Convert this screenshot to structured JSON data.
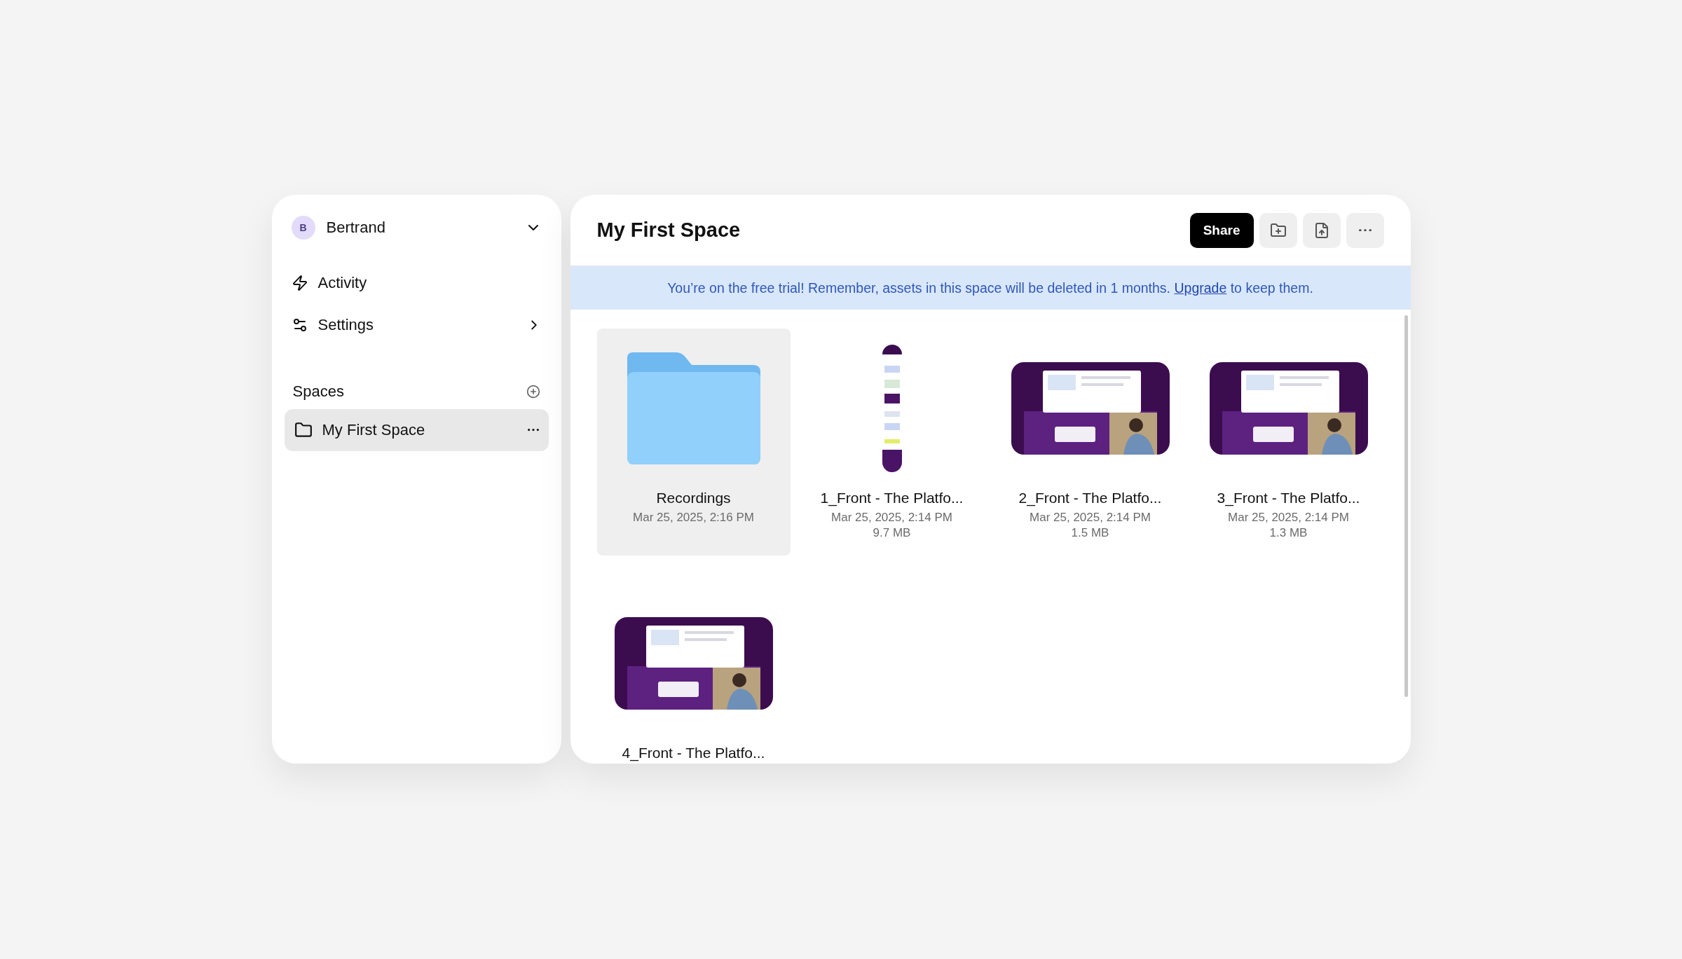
{
  "sidebar": {
    "user": {
      "initial": "B",
      "name": "Bertrand"
    },
    "nav": [
      {
        "kind": "activity",
        "label": "Activity",
        "submenu": false
      },
      {
        "kind": "settings",
        "label": "Settings",
        "submenu": true
      }
    ],
    "spaces": {
      "heading": "Spaces",
      "items": [
        {
          "label": "My First Space",
          "selected": true
        }
      ]
    }
  },
  "main": {
    "title": "My First Space",
    "share": "Share",
    "banner": {
      "text": "You’re on the free trial! Remember, assets in this space will be deleted in 1 months.",
      "link": "Upgrade",
      "after": "to keep them."
    },
    "items": [
      {
        "kind": "folder",
        "name": "Recordings",
        "date": "Mar 25, 2025, 2:16 PM",
        "selected": true
      },
      {
        "kind": "page",
        "name": "1_Front - The Platfo...",
        "date": "Mar 25, 2025, 2:14 PM",
        "size": "9.7 MB",
        "selected": false
      },
      {
        "kind": "screen",
        "name": "2_Front - The Platfo...",
        "date": "Mar 25, 2025, 2:14 PM",
        "size": "1.5 MB",
        "selected": false
      },
      {
        "kind": "screen",
        "name": "3_Front - The Platfo...",
        "date": "Mar 25, 2025, 2:14 PM",
        "size": "1.3 MB",
        "selected": false
      },
      {
        "kind": "screen",
        "name": "4_Front - The Platfo...",
        "selected": false
      }
    ]
  }
}
